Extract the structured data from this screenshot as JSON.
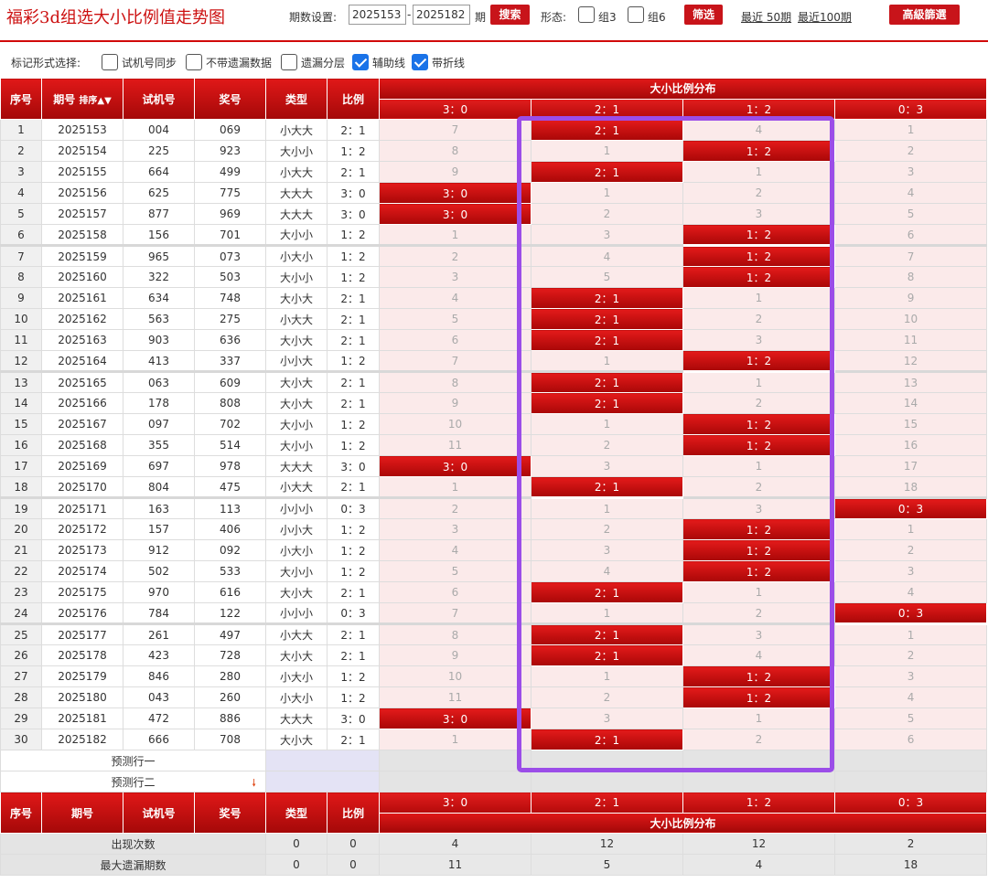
{
  "header": {
    "title": "福彩3d组选大小比例值走势图",
    "period_label": "期数设置:",
    "period_from": "2025153",
    "period_to": "2025182",
    "period_suffix": "期",
    "search_label": "搜索",
    "shape_label": "形态:",
    "group3_label": "组3",
    "group6_label": "组6",
    "filter_label": "筛选",
    "recent50": "最近 50期",
    "recent100": "最近100期",
    "advanced_label": "高級篩選"
  },
  "options": {
    "label": "标记形式选择:",
    "items": [
      {
        "label": "试机号同步",
        "checked": false
      },
      {
        "label": "不带遗漏数据",
        "checked": false
      },
      {
        "label": "遗漏分层",
        "checked": false
      },
      {
        "label": "辅助线",
        "checked": true
      },
      {
        "label": "带折线",
        "checked": true
      }
    ]
  },
  "table": {
    "headers": {
      "idx": "序号",
      "issue": "期号",
      "sort": "排序",
      "test": "试机号",
      "prize": "奖号",
      "type": "类型",
      "ratio": "比例",
      "dist": "大小比例分布"
    },
    "ratio_columns": [
      "3：0",
      "2：1",
      "1：2",
      "0：3"
    ],
    "rows": [
      {
        "idx": "1",
        "issue": "2025153",
        "test": "004",
        "prize": "069",
        "type": "小大大",
        "ratio": "2：1",
        "dist": [
          "7",
          "2：1",
          "4",
          "1"
        ]
      },
      {
        "idx": "2",
        "issue": "2025154",
        "test": "225",
        "prize": "923",
        "type": "大小小",
        "ratio": "1：2",
        "dist": [
          "8",
          "1",
          "1：2",
          "2"
        ]
      },
      {
        "idx": "3",
        "issue": "2025155",
        "test": "664",
        "prize": "499",
        "type": "小大大",
        "ratio": "2：1",
        "dist": [
          "9",
          "2：1",
          "1",
          "3"
        ]
      },
      {
        "idx": "4",
        "issue": "2025156",
        "test": "625",
        "prize": "775",
        "type": "大大大",
        "ratio": "3：0",
        "dist": [
          "3：0",
          "1",
          "2",
          "4"
        ]
      },
      {
        "idx": "5",
        "issue": "2025157",
        "test": "877",
        "prize": "969",
        "type": "大大大",
        "ratio": "3：0",
        "dist": [
          "3：0",
          "2",
          "3",
          "5"
        ]
      },
      {
        "idx": "6",
        "issue": "2025158",
        "test": "156",
        "prize": "701",
        "type": "大小小",
        "ratio": "1：2",
        "dist": [
          "1",
          "3",
          "1：2",
          "6"
        ]
      },
      {
        "idx": "7",
        "issue": "2025159",
        "test": "965",
        "prize": "073",
        "type": "小大小",
        "ratio": "1：2",
        "dist": [
          "2",
          "4",
          "1：2",
          "7"
        ]
      },
      {
        "idx": "8",
        "issue": "2025160",
        "test": "322",
        "prize": "503",
        "type": "大小小",
        "ratio": "1：2",
        "dist": [
          "3",
          "5",
          "1：2",
          "8"
        ]
      },
      {
        "idx": "9",
        "issue": "2025161",
        "test": "634",
        "prize": "748",
        "type": "大小大",
        "ratio": "2：1",
        "dist": [
          "4",
          "2：1",
          "1",
          "9"
        ]
      },
      {
        "idx": "10",
        "issue": "2025162",
        "test": "563",
        "prize": "275",
        "type": "小大大",
        "ratio": "2：1",
        "dist": [
          "5",
          "2：1",
          "2",
          "10"
        ]
      },
      {
        "idx": "11",
        "issue": "2025163",
        "test": "903",
        "prize": "636",
        "type": "大小大",
        "ratio": "2：1",
        "dist": [
          "6",
          "2：1",
          "3",
          "11"
        ]
      },
      {
        "idx": "12",
        "issue": "2025164",
        "test": "413",
        "prize": "337",
        "type": "小小大",
        "ratio": "1：2",
        "dist": [
          "7",
          "1",
          "1：2",
          "12"
        ]
      },
      {
        "idx": "13",
        "issue": "2025165",
        "test": "063",
        "prize": "609",
        "type": "大小大",
        "ratio": "2：1",
        "dist": [
          "8",
          "2：1",
          "1",
          "13"
        ]
      },
      {
        "idx": "14",
        "issue": "2025166",
        "test": "178",
        "prize": "808",
        "type": "大小大",
        "ratio": "2：1",
        "dist": [
          "9",
          "2：1",
          "2",
          "14"
        ]
      },
      {
        "idx": "15",
        "issue": "2025167",
        "test": "097",
        "prize": "702",
        "type": "大小小",
        "ratio": "1：2",
        "dist": [
          "10",
          "1",
          "1：2",
          "15"
        ]
      },
      {
        "idx": "16",
        "issue": "2025168",
        "test": "355",
        "prize": "514",
        "type": "大小小",
        "ratio": "1：2",
        "dist": [
          "11",
          "2",
          "1：2",
          "16"
        ]
      },
      {
        "idx": "17",
        "issue": "2025169",
        "test": "697",
        "prize": "978",
        "type": "大大大",
        "ratio": "3：0",
        "dist": [
          "3：0",
          "3",
          "1",
          "17"
        ]
      },
      {
        "idx": "18",
        "issue": "2025170",
        "test": "804",
        "prize": "475",
        "type": "小大大",
        "ratio": "2：1",
        "dist": [
          "1",
          "2：1",
          "2",
          "18"
        ]
      },
      {
        "idx": "19",
        "issue": "2025171",
        "test": "163",
        "prize": "113",
        "type": "小小小",
        "ratio": "0：3",
        "dist": [
          "2",
          "1",
          "3",
          "0：3"
        ]
      },
      {
        "idx": "20",
        "issue": "2025172",
        "test": "157",
        "prize": "406",
        "type": "小小大",
        "ratio": "1：2",
        "dist": [
          "3",
          "2",
          "1：2",
          "1"
        ]
      },
      {
        "idx": "21",
        "issue": "2025173",
        "test": "912",
        "prize": "092",
        "type": "小大小",
        "ratio": "1：2",
        "dist": [
          "4",
          "3",
          "1：2",
          "2"
        ]
      },
      {
        "idx": "22",
        "issue": "2025174",
        "test": "502",
        "prize": "533",
        "type": "大小小",
        "ratio": "1：2",
        "dist": [
          "5",
          "4",
          "1：2",
          "3"
        ]
      },
      {
        "idx": "23",
        "issue": "2025175",
        "test": "970",
        "prize": "616",
        "type": "大小大",
        "ratio": "2：1",
        "dist": [
          "6",
          "2：1",
          "1",
          "4"
        ]
      },
      {
        "idx": "24",
        "issue": "2025176",
        "test": "784",
        "prize": "122",
        "type": "小小小",
        "ratio": "0：3",
        "dist": [
          "7",
          "1",
          "2",
          "0：3"
        ]
      },
      {
        "idx": "25",
        "issue": "2025177",
        "test": "261",
        "prize": "497",
        "type": "小大大",
        "ratio": "2：1",
        "dist": [
          "8",
          "2：1",
          "3",
          "1"
        ]
      },
      {
        "idx": "26",
        "issue": "2025178",
        "test": "423",
        "prize": "728",
        "type": "大小大",
        "ratio": "2：1",
        "dist": [
          "9",
          "2：1",
          "4",
          "2"
        ]
      },
      {
        "idx": "27",
        "issue": "2025179",
        "test": "846",
        "prize": "280",
        "type": "小大小",
        "ratio": "1：2",
        "dist": [
          "10",
          "1",
          "1：2",
          "3"
        ]
      },
      {
        "idx": "28",
        "issue": "2025180",
        "test": "043",
        "prize": "260",
        "type": "小大小",
        "ratio": "1：2",
        "dist": [
          "11",
          "2",
          "1：2",
          "4"
        ]
      },
      {
        "idx": "29",
        "issue": "2025181",
        "test": "472",
        "prize": "886",
        "type": "大大大",
        "ratio": "3：0",
        "dist": [
          "3：0",
          "3",
          "1",
          "5"
        ]
      },
      {
        "idx": "30",
        "issue": "2025182",
        "test": "666",
        "prize": "708",
        "type": "大小大",
        "ratio": "2：1",
        "dist": [
          "1",
          "2：1",
          "2",
          "6"
        ]
      }
    ],
    "predict_rows": [
      "预测行一",
      "预测行二"
    ],
    "stats": [
      {
        "label": "出现次数",
        "type": "0",
        "ratio": "0",
        "values": [
          "4",
          "12",
          "12",
          "2"
        ]
      },
      {
        "label": "最大遗漏期数",
        "type": "0",
        "ratio": "0",
        "values": [
          "11",
          "5",
          "4",
          "18"
        ]
      }
    ]
  },
  "colors": {
    "accent": "#c8141a",
    "highlight_box": "#9b4de8",
    "checked": "#1a73e8"
  }
}
